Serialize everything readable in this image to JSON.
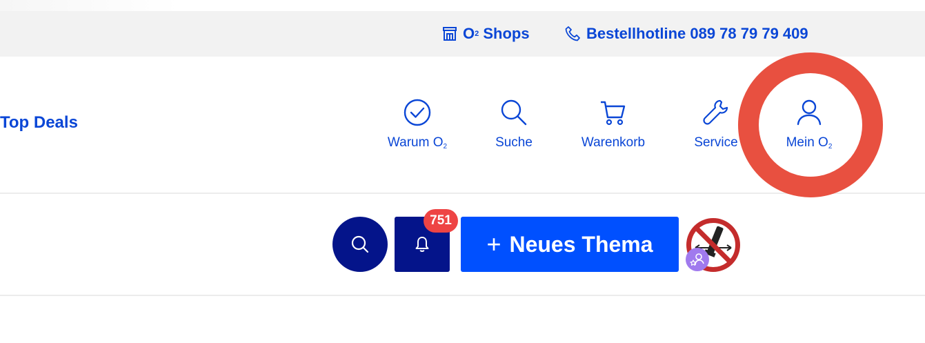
{
  "topbar": {
    "shops_label": "Shops",
    "shops_brand": "O",
    "shops_brand_sub": "2",
    "hotline_label": "Bestellhotline 089 78 79 79 409",
    "shops_icon": "store-icon",
    "hotline_icon": "phone-icon"
  },
  "header": {
    "top_deals": "Top Deals",
    "nav": [
      {
        "label": "Warum O",
        "sub": "2",
        "icon": "check-circle-icon"
      },
      {
        "label": "Suche",
        "sub": "",
        "icon": "search-icon"
      },
      {
        "label": "Warenkorb",
        "sub": "",
        "icon": "cart-icon"
      },
      {
        "label": "Service",
        "sub": "",
        "icon": "wrench-icon"
      },
      {
        "label": "Mein O",
        "sub": "2",
        "icon": "user-icon"
      }
    ]
  },
  "actions": {
    "notification_count": "751",
    "new_topic_plus": "+",
    "new_topic_label": "Neues Thema"
  },
  "colors": {
    "brand_blue": "#0a46d6",
    "dark_navy": "#04148a",
    "primary_button": "#0050ff",
    "badge_red": "#ee4444",
    "highlight_ring": "#e85040"
  }
}
